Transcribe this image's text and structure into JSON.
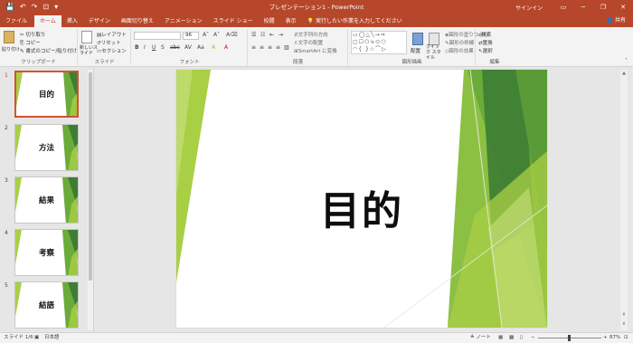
{
  "titlebar": {
    "title": "プレゼンテーション1 - PowerPoint",
    "signin": "サインイン",
    "qat": {
      "save": "save-icon",
      "undo": "undo-icon",
      "redo": "redo-icon",
      "present": "present-icon"
    },
    "window_buttons": [
      "─",
      "❐",
      "✕"
    ]
  },
  "tabs": [
    {
      "label": "ファイル",
      "active": false
    },
    {
      "label": "ホーム",
      "active": true
    },
    {
      "label": "挿入",
      "active": false
    },
    {
      "label": "デザイン",
      "active": false
    },
    {
      "label": "画面切り替え",
      "active": false
    },
    {
      "label": "アニメーション",
      "active": false
    },
    {
      "label": "スライド ショー",
      "active": false
    },
    {
      "label": "校閲",
      "active": false
    },
    {
      "label": "表示",
      "active": false
    }
  ],
  "tellme": "実行したい作業を入力してください",
  "share": "共有",
  "ribbon": {
    "clipboard": {
      "label": "クリップボード",
      "paste": "貼り付け",
      "cut": "切り取り",
      "copy": "コピー",
      "format_painter": "書式のコピー/貼り付け"
    },
    "slides": {
      "label": "スライド",
      "new_slide": "新しいスライド",
      "layout": "レイアウト",
      "reset": "リセット",
      "section": "セクション"
    },
    "font": {
      "label": "フォント",
      "font_name": "",
      "font_size": "96"
    },
    "paragraph": {
      "label": "段落",
      "text_direction": "文字列の方向",
      "align_text": "文字の配置",
      "smartart": "SmartArt に変換"
    },
    "drawing": {
      "label": "図形描画",
      "arrange": "配置",
      "quick_styles": "クイック スタイル",
      "shape_fill": "図形の塗りつぶし",
      "shape_outline": "図形の枠線",
      "shape_effects": "図形の効果"
    },
    "editing": {
      "label": "編集",
      "find": "検索",
      "replace": "置換",
      "select": "選択"
    }
  },
  "slides": [
    {
      "num": "1",
      "title": "目的",
      "active": true
    },
    {
      "num": "2",
      "title": "方法",
      "active": false
    },
    {
      "num": "3",
      "title": "結果",
      "active": false
    },
    {
      "num": "4",
      "title": "考察",
      "active": false
    },
    {
      "num": "5",
      "title": "結語",
      "active": false
    }
  ],
  "main_slide": {
    "title": "目的"
  },
  "status": {
    "slide_count": "スライド 1/6",
    "language": "日本語",
    "notes": "ノート",
    "zoom": "87%"
  },
  "colors": {
    "accent": "#b7472a",
    "green_light": "#a9cf45",
    "green_dark": "#3e7d34",
    "green_mid": "#6aab3a"
  }
}
